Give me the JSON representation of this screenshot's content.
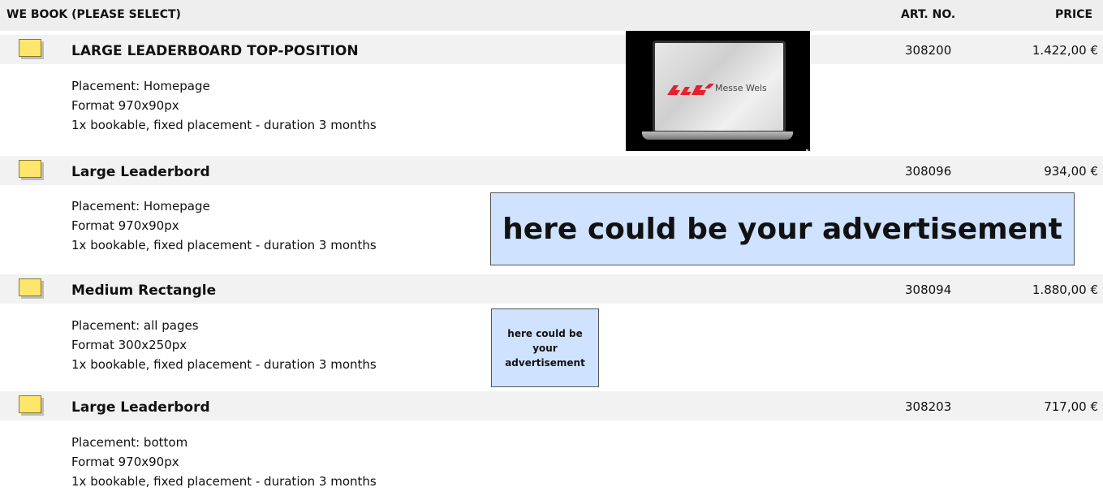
{
  "header": {
    "col_select": "WE BOOK (PLEASE SELECT)",
    "col_art": "ART. NO.",
    "col_price": "PRICE"
  },
  "items": [
    {
      "title": "LARGE LEADERBOARD TOP-POSITION",
      "art_no": "308200",
      "price": "1.422,00 €",
      "placement": "Placement: Homepage",
      "format": "Format 970x90px",
      "booking": "1x bookable, fixed placement - duration 3 months"
    },
    {
      "title": "Large Leaderbord",
      "art_no": "308096",
      "price": "934,00 €",
      "placement": "Placement: Homepage",
      "format": "Format 970x90px",
      "booking": "1x bookable, fixed placement - duration 3 months"
    },
    {
      "title": "Medium Rectangle",
      "art_no": "308094",
      "price": "1.880,00 €",
      "placement": "Placement: all pages",
      "format": "Format 300x250px",
      "booking": "1x bookable, fixed placement - duration 3 months"
    },
    {
      "title": "Large Leaderbord",
      "art_no": "308203",
      "price": "717,00 €",
      "placement": "Placement: bottom",
      "format": "Format 970x90px",
      "booking": "1x bookable, fixed placement - duration 3 months"
    }
  ],
  "preview_image": {
    "brand_text": "Messe Wels",
    "logo_color": "#e5202e"
  },
  "ad_big": {
    "text": "here could be your advertisement"
  },
  "ad_small": {
    "text": "here could be your advertisement"
  },
  "colors": {
    "checkbox": "#fde66b",
    "ad_fill": "#cfe2ff",
    "row_bg": "#f2f2f2"
  }
}
